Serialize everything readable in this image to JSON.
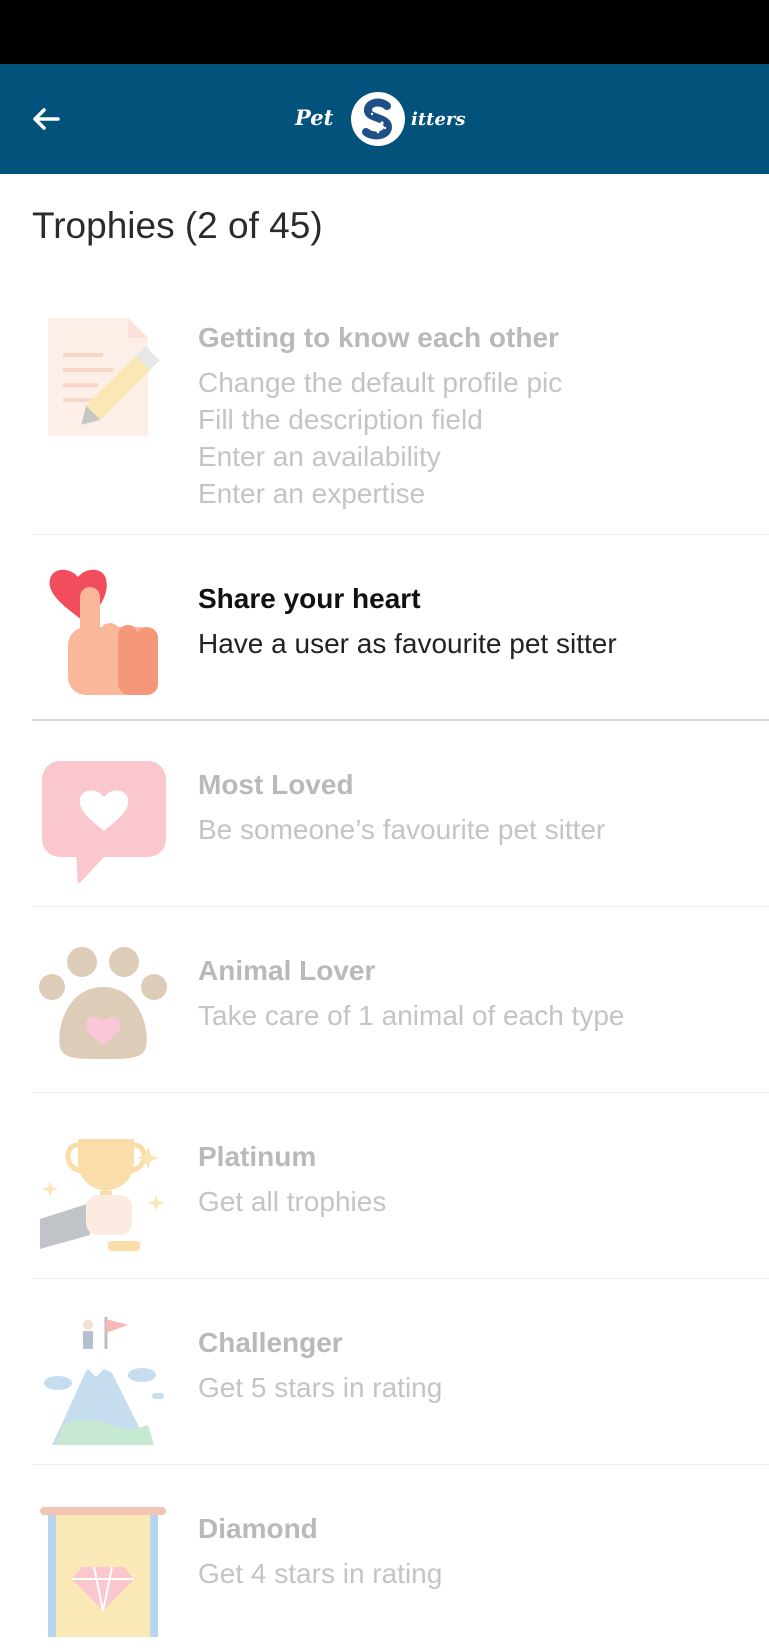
{
  "app_bar": {
    "logo_left": "Pet",
    "logo_right": "itters",
    "logo_letter": "S"
  },
  "page": {
    "title": "Trophies (2 of 45)"
  },
  "trophies": [
    {
      "title": "Getting to know each other",
      "requirements": [
        "Change the default profile pic",
        "Fill the description field",
        "Enter an availability",
        "Enter an expertise"
      ],
      "icon": "document-pencil-icon",
      "unlocked": false
    },
    {
      "title": "Share your heart",
      "requirements": [
        "Have a user as favourite pet sitter"
      ],
      "icon": "hand-heart-icon",
      "unlocked": true
    },
    {
      "title": "Most Loved",
      "requirements": [
        "Be someone’s favourite pet sitter"
      ],
      "icon": "heart-speech-bubble-icon",
      "unlocked": false
    },
    {
      "title": "Animal Lover",
      "requirements": [
        "Take care of 1 animal of each type"
      ],
      "icon": "paw-heart-icon",
      "unlocked": false
    },
    {
      "title": "Platinum",
      "requirements": [
        "Get all trophies"
      ],
      "icon": "trophy-hand-icon",
      "unlocked": false
    },
    {
      "title": "Challenger",
      "requirements": [
        "Get 5 stars in rating"
      ],
      "icon": "mountain-flag-icon",
      "unlocked": false
    },
    {
      "title": "Diamond",
      "requirements": [
        "Get 4 stars in rating"
      ],
      "icon": "diamond-banner-icon",
      "unlocked": false
    }
  ],
  "colors": {
    "app_bar": "#02527c",
    "status_bar": "#000000"
  }
}
